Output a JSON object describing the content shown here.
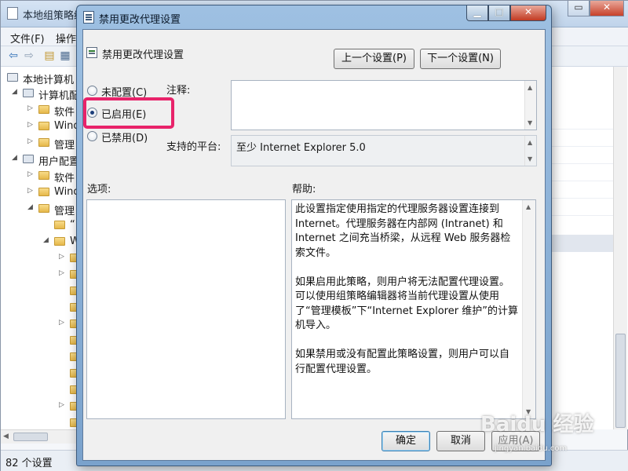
{
  "main_window": {
    "title": "本地组策略编",
    "menu": [
      "文件(F)",
      "操作"
    ],
    "tree": [
      {
        "label": "本地计算机",
        "indent": 0,
        "arrow": ""
      },
      {
        "label": "计算机配",
        "indent": 1,
        "arrow": "◢"
      },
      {
        "label": "软件",
        "indent": 2,
        "arrow": "▷"
      },
      {
        "label": "Wind",
        "indent": 2,
        "arrow": "▷"
      },
      {
        "label": "管理",
        "indent": 2,
        "arrow": "▷"
      },
      {
        "label": "用户配置",
        "indent": 1,
        "arrow": "◢"
      },
      {
        "label": "软件",
        "indent": 2,
        "arrow": "▷"
      },
      {
        "label": "Wind",
        "indent": 2,
        "arrow": "▷"
      },
      {
        "label": "管理",
        "indent": 2,
        "arrow": "◢"
      },
      {
        "label": "“",
        "indent": 3,
        "arrow": ""
      },
      {
        "label": "W",
        "indent": 3,
        "arrow": "◢"
      }
    ],
    "status": "82 个设置"
  },
  "dialog": {
    "title": "禁用更改代理设置",
    "policy_name": "禁用更改代理设置",
    "prev_button": "上一个设置(P)",
    "next_button": "下一个设置(N)",
    "radio_not_configured": "未配置(C)",
    "radio_enabled": "已启用(E)",
    "radio_disabled": "已禁用(D)",
    "comment_label": "注释:",
    "platform_label": "支持的平台:",
    "platform_value": "至少 Internet Explorer 5.0",
    "options_label": "选项:",
    "help_label": "帮助:",
    "help_paragraphs": [
      "此设置指定使用指定的代理服务器设置连接到 Internet。代理服务器在内部网 (Intranet) 和 Internet 之间充当桥梁，从远程 Web 服务器检索文件。",
      "如果启用此策略，则用户将无法配置代理设置。可以使用组策略编辑器将当前代理设置从使用了“管理模板”下“Internet Explorer 维护”的计算机导入。",
      "如果禁用或没有配置此策略设置，则用户可以自行配置代理设置。"
    ],
    "ok_button": "确定",
    "cancel_button": "取消",
    "apply_button": "应用(A)"
  },
  "watermark": {
    "text": "Baidu 经验",
    "sub": "jingyan.baidu.com"
  },
  "colors": {
    "highlight": "#e8236a",
    "dialog_frame": "#7aa2cc"
  }
}
